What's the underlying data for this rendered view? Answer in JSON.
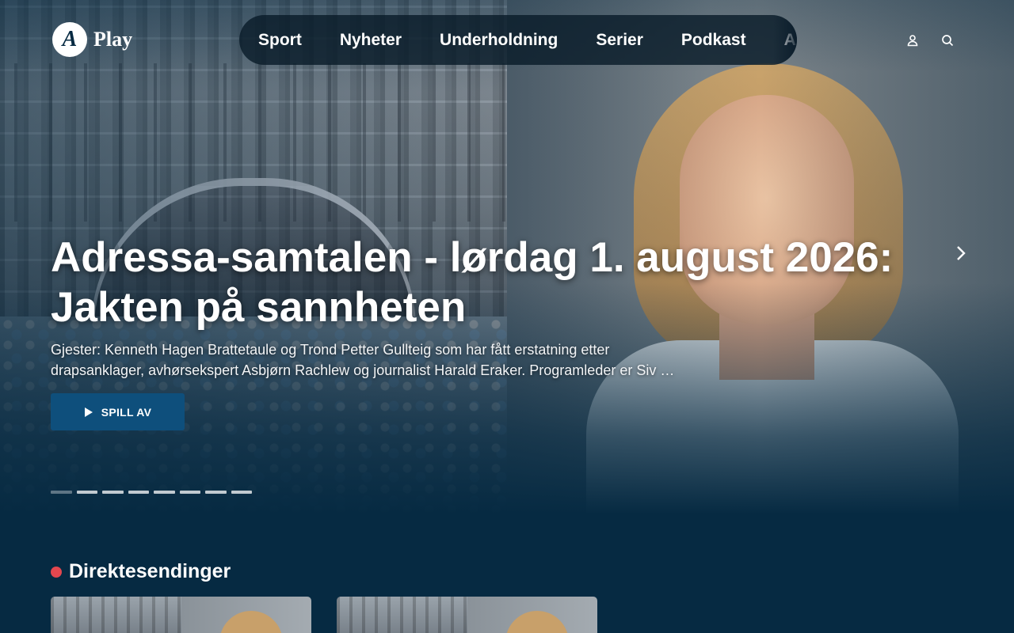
{
  "brand": {
    "name": "Play",
    "mark": "A"
  },
  "nav": {
    "items": [
      "Sport",
      "Nyheter",
      "Underholdning",
      "Serier",
      "Podkast",
      "A"
    ]
  },
  "header_icons": [
    "user-icon",
    "search-icon"
  ],
  "hero": {
    "title": "Adressa-samtalen - lørdag 1. august 2026: Jakten på sannheten",
    "description": "Gjester: Kenneth Hagen Brattetaule og Trond Petter Gullteig som har fått erstatning etter drapsanklager, avhørsekspert Asbjørn Rachlew og journalist Harald Eraker. Programleder er Siv …",
    "play_label": "SPILL AV",
    "slide_count": 8,
    "active_slide": 1
  },
  "live_section": {
    "title": "Direktesendinger",
    "live_color": "#e3474f",
    "cards": 2
  },
  "colors": {
    "background": "#062a42",
    "button": "#0e4f7c",
    "nav_bg": "#0a1c2a"
  }
}
